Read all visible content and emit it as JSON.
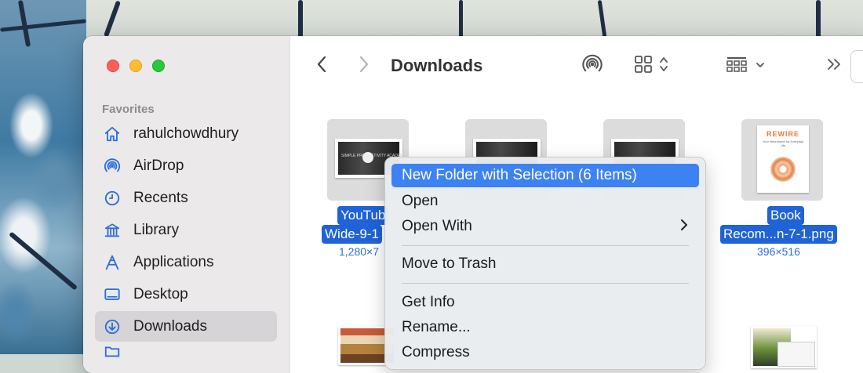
{
  "sidebar": {
    "section_title": "Favorites",
    "items": [
      {
        "label": "rahulchowdhury",
        "icon": "home-icon"
      },
      {
        "label": "AirDrop",
        "icon": "airdrop-icon"
      },
      {
        "label": "Recents",
        "icon": "clock-icon"
      },
      {
        "label": "Library",
        "icon": "library-icon"
      },
      {
        "label": "Applications",
        "icon": "applications-icon"
      },
      {
        "label": "Desktop",
        "icon": "desktop-icon"
      },
      {
        "label": "Downloads",
        "icon": "download-icon",
        "active": true
      }
    ]
  },
  "toolbar": {
    "title": "Downloads",
    "back_icon": "chevron-left-icon",
    "forward_icon": "chevron-right-icon",
    "airdrop_icon": "airdrop-icon",
    "view_icon": "grid-view-icon",
    "group_icon": "group-view-icon",
    "more_icon": "double-chevron-icon"
  },
  "files": [
    {
      "name_line1": "YouTub",
      "name_line2": "Wide-9-1",
      "meta": "1,280×7",
      "thumb_text": "SIMPLE PRODUCTIVITY ACADEMY"
    },
    {
      "name_line1": "",
      "name_line2": "",
      "meta": ""
    },
    {
      "name_line1": "",
      "name_line2": "",
      "meta": ""
    },
    {
      "name_line1": "Book",
      "name_line2": "Recom...n-7-1.png",
      "meta": "396×516"
    }
  ],
  "book": {
    "title": "REWIRE",
    "subtitle": "Your Neurohabit for Everyday Life",
    "accent": "#e07c3c"
  },
  "context_menu": {
    "items": [
      {
        "label": "New Folder with Selection (6 Items)",
        "highlighted": true
      },
      {
        "label": "Open"
      },
      {
        "label": "Open With",
        "submenu": true
      },
      {
        "label": "Move to Trash"
      },
      {
        "label": "Get Info"
      },
      {
        "label": "Rename..."
      },
      {
        "label": "Compress"
      }
    ]
  },
  "colors": {
    "selection": "#1f63d6",
    "menu_highlight": "#3d82f2",
    "accent_icon": "#2a6fd8"
  }
}
